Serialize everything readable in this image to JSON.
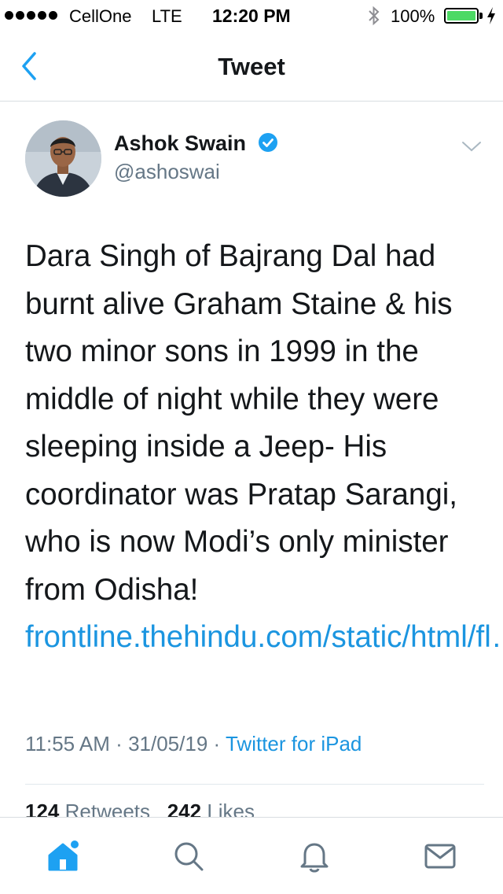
{
  "status_bar": {
    "carrier": "CellOne",
    "network": "LTE",
    "time": "12:20 PM",
    "battery_percent": "100%",
    "battery_level": 1.0,
    "signal_bars": 5
  },
  "nav": {
    "title": "Tweet",
    "back_icon": "chevron-left-icon"
  },
  "tweet": {
    "author": {
      "display_name": "Ashok Swain",
      "handle": "@ashoswai",
      "verified": true
    },
    "text": "Dara Singh of Bajrang Dal had burnt alive Graham Staine & his two minor sons in 1999 in the middle of night while they were sleeping inside a Jeep- His coordinator was Pratap Sarangi, who is now Modi’s only minister from Odisha!",
    "link": "frontline.thehindu.com/static/html/fl…",
    "time": "11:55 AM",
    "date": "31/05/19",
    "separator": "·",
    "source": "Twitter for iPad",
    "stats": {
      "retweets_count": "124",
      "retweets_label": "Retweets",
      "likes_count": "242",
      "likes_label": "Likes"
    }
  },
  "tabbar": {
    "items": [
      {
        "icon": "home-icon",
        "active": true
      },
      {
        "icon": "search-icon",
        "active": false
      },
      {
        "icon": "notifications-icon",
        "active": false
      },
      {
        "icon": "messages-icon",
        "active": false
      }
    ]
  },
  "colors": {
    "accent": "#1da1f2",
    "link": "#1b95e0",
    "text": "#14171a",
    "secondary": "#657786",
    "battery": "#4cd964"
  }
}
